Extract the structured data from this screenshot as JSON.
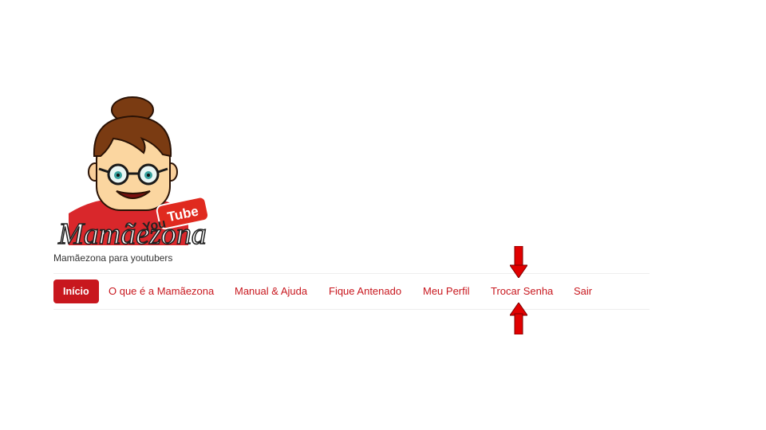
{
  "site": {
    "logo_text": "Mamãezona",
    "logo_badge": "YouTube",
    "tagline": "Mamãezona para youtubers"
  },
  "nav": {
    "items": [
      {
        "label": "Início",
        "active": true
      },
      {
        "label": "O que é a Mamãezona"
      },
      {
        "label": "Manual & Ajuda"
      },
      {
        "label": "Fique Antenado"
      },
      {
        "label": "Meu Perfil"
      },
      {
        "label": "Trocar Senha"
      },
      {
        "label": "Sair"
      }
    ]
  },
  "annotation": {
    "arrow_color": "#e10000",
    "target": "Trocar Senha"
  },
  "colors": {
    "accent": "#c8171e",
    "active_text": "#ffffff"
  }
}
